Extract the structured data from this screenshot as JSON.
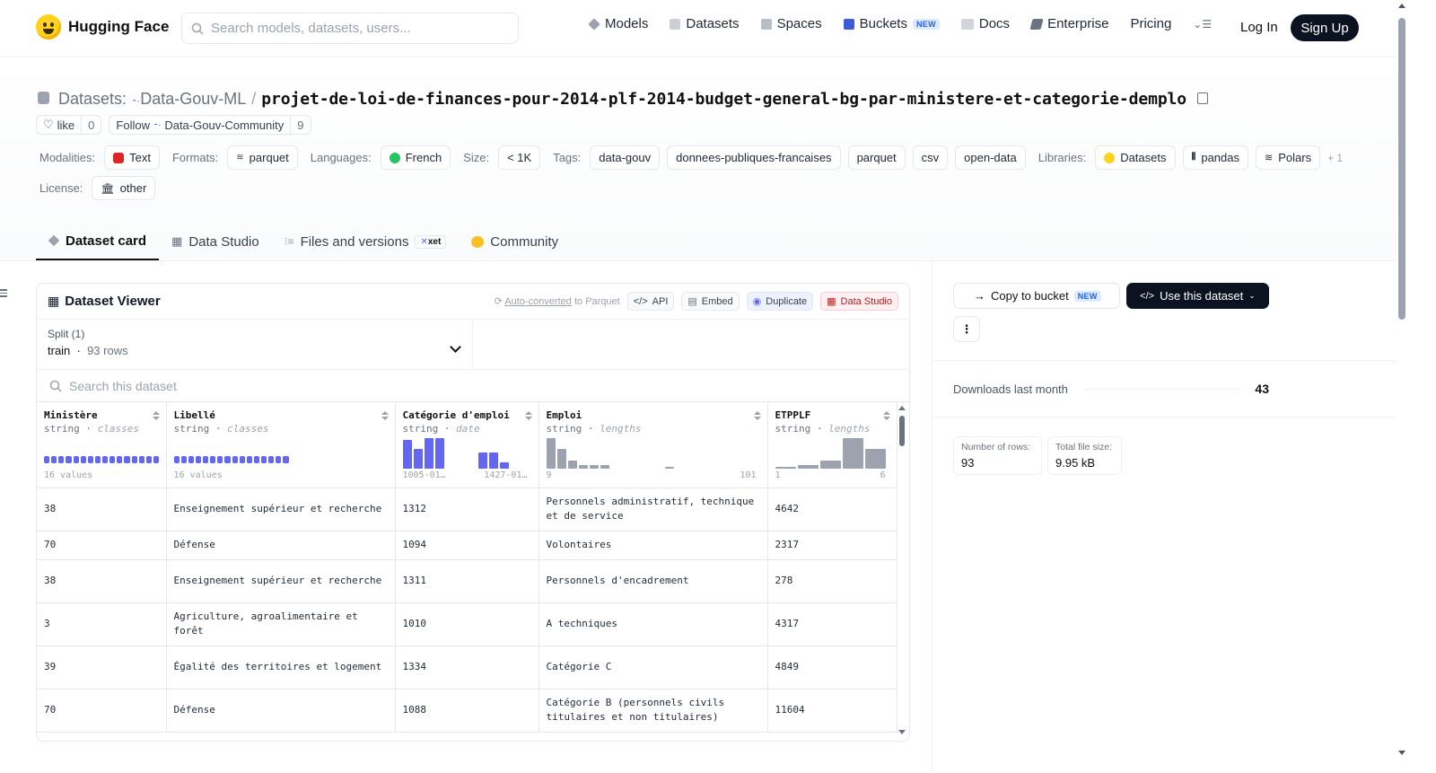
{
  "brand": {
    "name": "Hugging Face"
  },
  "search": {
    "placeholder": "Search models, datasets, users..."
  },
  "nav": {
    "items": [
      {
        "label": "Models",
        "icon": "models-icon",
        "color": "#9ca3af"
      },
      {
        "label": "Datasets",
        "icon": "datasets-icon",
        "color": "#9ca3af"
      },
      {
        "label": "Spaces",
        "icon": "spaces-icon",
        "color": "#9ca3af"
      },
      {
        "label": "Buckets",
        "icon": "buckets-icon",
        "color": "#3b5bdb",
        "badge": "NEW"
      },
      {
        "label": "Docs",
        "icon": "docs-icon",
        "color": "#9ca3af"
      },
      {
        "label": "Enterprise",
        "icon": "enterprise-icon",
        "color": "#6b7280"
      },
      {
        "label": "Pricing"
      }
    ],
    "login": "Log In",
    "signup": "Sign Up"
  },
  "dataset": {
    "prefix": "Datasets:",
    "org": "Data-Gouv-ML",
    "name": "projet-de-loi-de-finances-pour-2014-plf-2014-budget-general-bg-par-ministere-et-categorie-demplo",
    "like_label": "like",
    "like_count": "0",
    "follow_label": "Follow",
    "follow_org": "Data-Gouv-Community",
    "follow_count": "9"
  },
  "meta": {
    "modalities_label": "Modalities:",
    "modality": "Text",
    "formats_label": "Formats:",
    "format": "parquet",
    "languages_label": "Languages:",
    "language": "French",
    "size_label": "Size:",
    "size": "< 1K",
    "tags_label": "Tags:",
    "tags": [
      "data-gouv",
      "donnees-publiques-francaises",
      "parquet",
      "csv",
      "open-data"
    ],
    "libraries_label": "Libraries:",
    "libraries": [
      "Datasets",
      "pandas",
      "Polars"
    ],
    "libraries_more": "+ 1",
    "license_label": "License:",
    "license": "other"
  },
  "tabs": [
    {
      "label": "Dataset card",
      "active": true
    },
    {
      "label": "Data Studio"
    },
    {
      "label": "Files and versions",
      "badge": "xet"
    },
    {
      "label": "Community"
    }
  ],
  "viewer": {
    "title": "Dataset Viewer",
    "auto_converted": "Auto-converted",
    "auto_converted_suffix": "to Parquet",
    "api": "API",
    "embed": "Embed",
    "duplicate": "Duplicate",
    "data_studio": "Data Studio",
    "split_label": "Split (1)",
    "split_name": "train",
    "split_rows": "93 rows",
    "search_placeholder": "Search this dataset",
    "columns": [
      {
        "name": "Ministère",
        "type": "string",
        "stat": "classes",
        "foot_left": "16 values",
        "foot_right": "",
        "viz": "classes",
        "segments": 16
      },
      {
        "name": "Libellé",
        "type": "string",
        "stat": "classes",
        "foot_left": "16 values",
        "foot_right": "",
        "viz": "classes",
        "segments": 16
      },
      {
        "name": "Catégorie d'emploi",
        "type": "string",
        "stat": "date",
        "foot_left": "1005-01…",
        "foot_right": "1427-01…",
        "viz": "hist",
        "color": "#6366f1",
        "bins": [
          0.9,
          0.6,
          0.95,
          0.95,
          0,
          0,
          0,
          0.5,
          0.5,
          0.2
        ]
      },
      {
        "name": "Emploi",
        "type": "string",
        "stat": "lengths",
        "foot_left": "9",
        "foot_right": "101",
        "viz": "hist",
        "color": "#9ca3af",
        "bins": [
          0.95,
          0.6,
          0.25,
          0.12,
          0.12,
          0.1,
          0,
          0,
          0,
          0,
          0,
          0.05
        ]
      },
      {
        "name": "ETPPLF",
        "type": "string",
        "stat": "lengths",
        "foot_left": "1",
        "foot_right": "6",
        "viz": "hist-wide",
        "color": "#9ca3af",
        "bins": [
          0.05,
          0.1,
          0.25,
          0.95,
          0.6
        ]
      }
    ],
    "rows": [
      [
        "38",
        "Enseignement supérieur et recherche",
        "1312",
        "Personnels administratif, technique et de service",
        "4642"
      ],
      [
        "70",
        "Défense",
        "1094",
        "Volontaires",
        "2317"
      ],
      [
        "38",
        "Enseignement supérieur et recherche",
        "1311",
        "Personnels d'encadrement",
        "278"
      ],
      [
        "3",
        "Agriculture, agroalimentaire et forêt",
        "1010",
        "A techniques",
        "4317"
      ],
      [
        "39",
        "Égalité des territoires et logement",
        "1334",
        "Catégorie C",
        "4849"
      ],
      [
        "70",
        "Défense",
        "1088",
        "Catégorie B (personnels civils titulaires et non titulaires)",
        "11604"
      ]
    ]
  },
  "sidebar": {
    "copy_bucket": "Copy to bucket",
    "copy_bucket_badge": "NEW",
    "use_dataset": "Use this dataset",
    "kebab": "⋮",
    "downloads_label": "Downloads last month",
    "downloads_value": "43",
    "rows_label": "Number of rows:",
    "rows_value": "93",
    "size_label": "Total file size:",
    "size_value": "9.95 kB"
  }
}
